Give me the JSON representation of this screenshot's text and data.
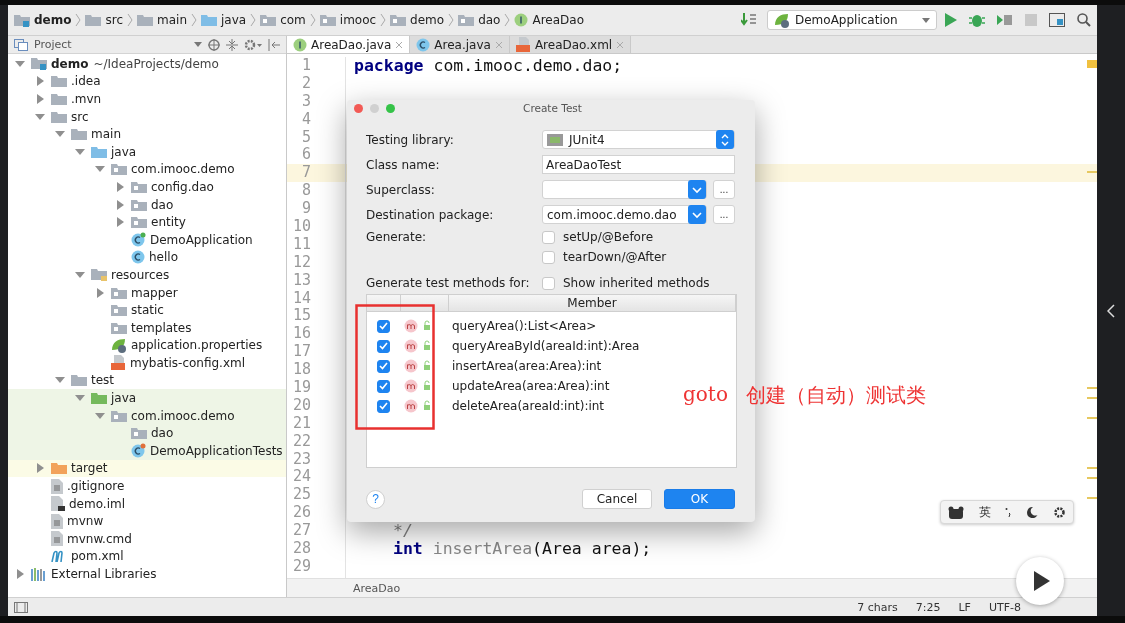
{
  "navbar": {
    "crumbs": [
      {
        "label": "demo",
        "kind": "module"
      },
      {
        "label": "src",
        "kind": "folder"
      },
      {
        "label": "main",
        "kind": "folder"
      },
      {
        "label": "java",
        "kind": "source"
      },
      {
        "label": "com",
        "kind": "package"
      },
      {
        "label": "imooc",
        "kind": "package"
      },
      {
        "label": "demo",
        "kind": "package"
      },
      {
        "label": "dao",
        "kind": "package"
      },
      {
        "label": "AreaDao",
        "kind": "interface"
      }
    ],
    "run_config": "DemoApplication"
  },
  "project_panel": {
    "title": "Project",
    "tree": [
      {
        "label": "demo",
        "detail": "~/IdeaProjects/demo",
        "kind": "module",
        "expanded": true,
        "children": [
          {
            "label": ".idea",
            "kind": "folder",
            "expanded": false
          },
          {
            "label": ".mvn",
            "kind": "folder",
            "expanded": false
          },
          {
            "label": "src",
            "kind": "folder",
            "expanded": true,
            "children": [
              {
                "label": "main",
                "kind": "folder",
                "expanded": true,
                "children": [
                  {
                    "label": "java",
                    "kind": "source",
                    "expanded": true,
                    "children": [
                      {
                        "label": "com.imooc.demo",
                        "kind": "package",
                        "expanded": true,
                        "children": [
                          {
                            "label": "config.dao",
                            "kind": "package",
                            "expanded": false
                          },
                          {
                            "label": "dao",
                            "kind": "package",
                            "expanded": false
                          },
                          {
                            "label": "entity",
                            "kind": "package",
                            "expanded": false
                          },
                          {
                            "label": "DemoApplication",
                            "kind": "spring-class"
                          },
                          {
                            "label": "hello",
                            "kind": "class"
                          }
                        ]
                      }
                    ]
                  },
                  {
                    "label": "resources",
                    "kind": "resources",
                    "expanded": true,
                    "children": [
                      {
                        "label": "mapper",
                        "kind": "package",
                        "expanded": false
                      },
                      {
                        "label": "static",
                        "kind": "package"
                      },
                      {
                        "label": "templates",
                        "kind": "package"
                      },
                      {
                        "label": "application.properties",
                        "kind": "spring"
                      },
                      {
                        "label": "mybatis-config.xml",
                        "kind": "xml"
                      }
                    ]
                  }
                ]
              },
              {
                "label": "test",
                "kind": "folder",
                "expanded": true,
                "children": [
                  {
                    "label": "java",
                    "kind": "test-source",
                    "test_scope": true,
                    "expanded": true,
                    "children": [
                      {
                        "label": "com.imooc.demo",
                        "kind": "package",
                        "test_scope": true,
                        "expanded": true,
                        "children": [
                          {
                            "label": "dao",
                            "kind": "package",
                            "test_scope": true
                          },
                          {
                            "label": "DemoApplicationTests",
                            "kind": "test-class",
                            "test_scope": true
                          }
                        ]
                      }
                    ]
                  }
                ]
              }
            ]
          },
          {
            "label": "target",
            "kind": "excluded",
            "excluded": true,
            "expanded": false
          },
          {
            "label": ".gitignore",
            "kind": "file"
          },
          {
            "label": "demo.iml",
            "kind": "iml"
          },
          {
            "label": "mvnw",
            "kind": "file"
          },
          {
            "label": "mvnw.cmd",
            "kind": "file"
          },
          {
            "label": "pom.xml",
            "kind": "maven"
          }
        ]
      },
      {
        "label": "External Libraries",
        "kind": "library",
        "expanded": false
      }
    ]
  },
  "tabs": [
    {
      "label": "AreaDao.java",
      "kind": "interface",
      "selected": true
    },
    {
      "label": "Area.java",
      "kind": "class",
      "selected": false
    },
    {
      "label": "AreaDao.xml",
      "kind": "xml",
      "selected": false
    }
  ],
  "editor": {
    "lines": [
      {
        "number": "1",
        "current": false,
        "code": [
          {
            "kind": "keyword",
            "text": "package"
          },
          {
            "kind": "plain",
            "text": " com.imooc.demo.dao;"
          }
        ]
      },
      {
        "number": "2",
        "current": false
      },
      {
        "number": "3",
        "current": false
      },
      {
        "number": "4",
        "current": false
      },
      {
        "number": "5",
        "current": false
      },
      {
        "number": "6",
        "current": false
      },
      {
        "number": "7",
        "current": true
      },
      {
        "number": "8",
        "current": false
      },
      {
        "number": "9",
        "current": false
      },
      {
        "number": "10",
        "current": false
      },
      {
        "number": "11",
        "current": false
      },
      {
        "number": "12",
        "current": false
      },
      {
        "number": "13",
        "current": false
      },
      {
        "number": "14",
        "current": false
      },
      {
        "number": "15",
        "current": false
      },
      {
        "number": "16",
        "current": false
      },
      {
        "number": "17",
        "current": false
      },
      {
        "number": "18",
        "current": false
      },
      {
        "number": "19",
        "current": false
      },
      {
        "number": "20",
        "current": false
      },
      {
        "number": "21",
        "current": false
      },
      {
        "number": "22",
        "current": false
      },
      {
        "number": "23",
        "current": false
      },
      {
        "number": "24",
        "current": false
      },
      {
        "number": "25",
        "current": false
      },
      {
        "number": "26",
        "current": false
      },
      {
        "number": "27",
        "current": false,
        "indented": true,
        "code": [
          {
            "kind": "comment",
            "text": "*/"
          }
        ]
      },
      {
        "number": "28",
        "current": false,
        "indented": true,
        "code": [
          {
            "kind": "keyword",
            "text": "int"
          },
          {
            "kind": "unused",
            "text": " insertArea"
          },
          {
            "kind": "plain",
            "text": "(Area area);"
          }
        ]
      },
      {
        "number": "29",
        "current": false
      }
    ],
    "breadcrumb": "AreaDao"
  },
  "dialog": {
    "title": "Create Test",
    "library": {
      "label": "Testing library:",
      "value": "JUnit4"
    },
    "class_name": {
      "label": "Class name:",
      "value": "AreaDaoTest"
    },
    "superclass": {
      "label": "Superclass:",
      "browse": "..."
    },
    "destination": {
      "label": "Destination package:",
      "value": "com.imooc.demo.dao",
      "browse": "..."
    },
    "generate": {
      "label": "Generate:",
      "options": [
        {
          "label": "setUp/@Before",
          "checked": false
        },
        {
          "label": "tearDown/@After",
          "checked": false
        }
      ]
    },
    "methods": {
      "label": "Generate test methods for:",
      "show_inherited": {
        "label": "Show inherited methods",
        "checked": false
      },
      "column": "Member",
      "members": [
        {
          "signature": "queryArea():List<Area>",
          "checked": true
        },
        {
          "signature": "queryAreaById(areaId:int):Area",
          "checked": true
        },
        {
          "signature": "insertArea(area:Area):int",
          "checked": true
        },
        {
          "signature": "updateArea(area:Area):int",
          "checked": true
        },
        {
          "signature": "deleteArea(areaId:int):int",
          "checked": true
        }
      ]
    },
    "help": "?",
    "buttons": [
      {
        "label": "Cancel",
        "kind": "secondary"
      },
      {
        "label": "OK",
        "kind": "primary"
      }
    ]
  },
  "annotation": {
    "code": "goto",
    "text": "创建（自动）测试类"
  },
  "ime_toolbar": {
    "language": "英"
  },
  "status_bar": {
    "chars": "7 chars",
    "position": "7:25",
    "line_separator": "LF",
    "encoding": "UTF-8"
  }
}
